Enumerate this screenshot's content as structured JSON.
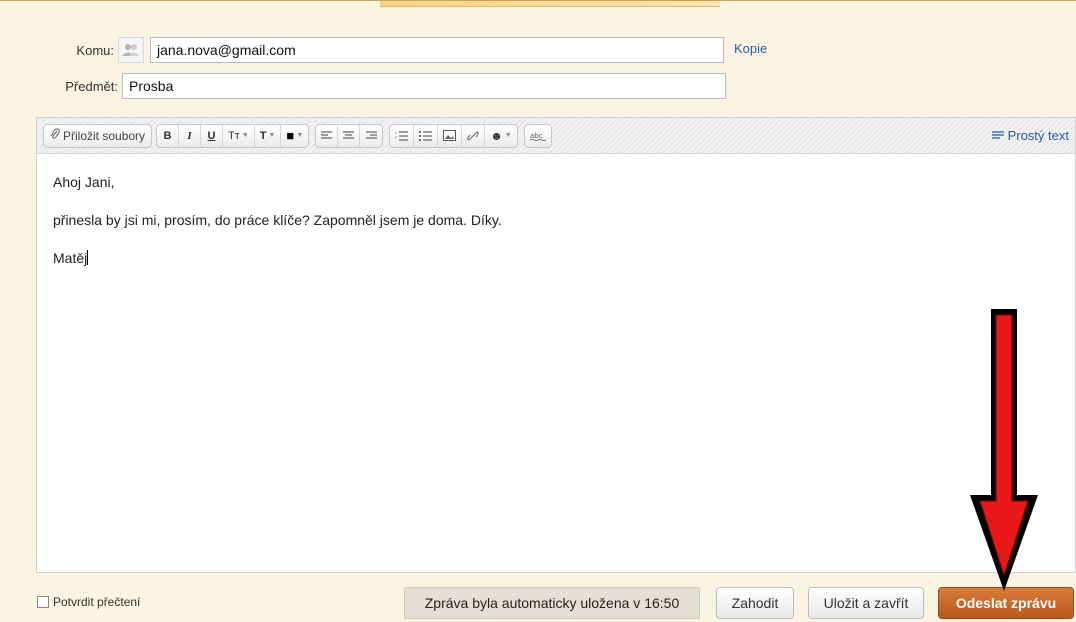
{
  "header": {
    "to_label": "Komu:",
    "to_value": "jana.nova@gmail.com",
    "copy_link": "Kopie",
    "subject_label": "Předmět:",
    "subject_value": "Prosba"
  },
  "toolbar": {
    "attach_label": "Přiložit soubory",
    "plain_text_label": "Prostý text",
    "format_buttons": [
      "B",
      "I",
      "U",
      "Tт",
      "T",
      "■"
    ],
    "icons": [
      "paperclip-icon",
      "bold-icon",
      "italic-icon",
      "underline-icon",
      "font-size-icon",
      "font-color-icon",
      "text-color-icon",
      "align-left-icon",
      "align-center-icon",
      "align-right-icon",
      "ordered-list-icon",
      "unordered-list-icon",
      "image-icon",
      "link-icon",
      "emoji-icon",
      "spellcheck-icon",
      "plain-text-icon"
    ]
  },
  "message": {
    "greeting": "Ahoj Jani,",
    "body": "přinesla by jsi mi, prosím, do práce klíče? Zapomněl jsem je doma. Díky.",
    "signature": "Matěj"
  },
  "footer": {
    "read_receipt_label": "Potvrdit přečtení",
    "autosave_text": "Zpráva byla automaticky uložena v 16:50",
    "discard_label": "Zahodit",
    "save_close_label": "Uložit a zavřít",
    "send_label": "Odeslat zprávu"
  },
  "colors": {
    "background": "#fcf4e2",
    "link": "#2a5aa8",
    "send_button": "#c96b28",
    "annotation_arrow": "#e81818"
  }
}
